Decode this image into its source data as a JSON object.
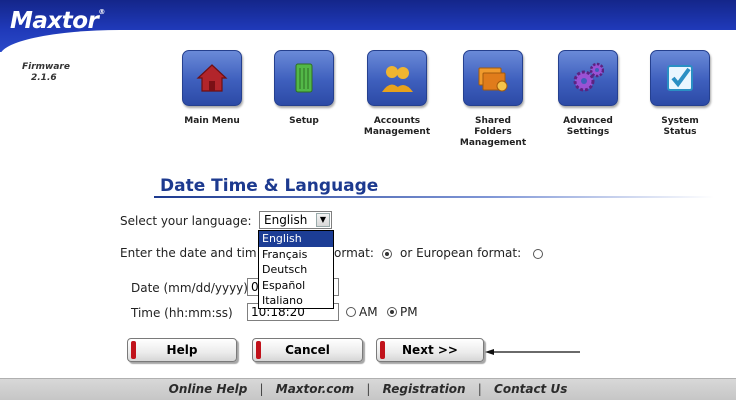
{
  "brand": {
    "logo": "Maxtor",
    "firmware_label": "Firmware",
    "firmware_version": "2.1.6"
  },
  "nav": [
    {
      "id": "main-menu",
      "label_lines": [
        "Main Menu"
      ],
      "icon": "house-icon",
      "accent": "#b2252b"
    },
    {
      "id": "setup",
      "label_lines": [
        "Setup"
      ],
      "icon": "drive-icon",
      "accent": "#49a63c"
    },
    {
      "id": "accounts",
      "label_lines": [
        "Accounts",
        "Management"
      ],
      "icon": "users-icon",
      "accent": "#e8a21c"
    },
    {
      "id": "shared-folders",
      "label_lines": [
        "Shared",
        "Folders",
        "Management"
      ],
      "icon": "folders-icon",
      "accent": "#e07c1b"
    },
    {
      "id": "advanced",
      "label_lines": [
        "Advanced",
        "Settings"
      ],
      "icon": "gears-icon",
      "accent": "#8a44c4"
    },
    {
      "id": "system-status",
      "label_lines": [
        "System",
        "Status"
      ],
      "icon": "checkbox-icon",
      "accent": "#2a8fc4"
    }
  ],
  "section": {
    "title": "Date Time & Language"
  },
  "language": {
    "label": "Select your language:",
    "selected": "English",
    "options": [
      "English",
      "Français",
      "Deutsch",
      "Español",
      "Italiano"
    ]
  },
  "format": {
    "prompt_start": "Enter the date and tim",
    "prompt_end": "ormat:",
    "european_label": "or European format:",
    "us_selected": true,
    "european_selected": false
  },
  "date": {
    "label": "Date (mm/dd/yyyy)",
    "value": "0"
  },
  "time": {
    "label": "Time (hh:mm:ss)",
    "value": "10:18:20",
    "am_label": "AM",
    "pm_label": "PM",
    "period": "PM"
  },
  "buttons": {
    "help": "Help",
    "cancel": "Cancel",
    "next": "Next >>"
  },
  "footer": {
    "links": [
      "Online Help",
      "Maxtor.com",
      "Registration",
      "Contact Us"
    ],
    "separator": "|"
  }
}
